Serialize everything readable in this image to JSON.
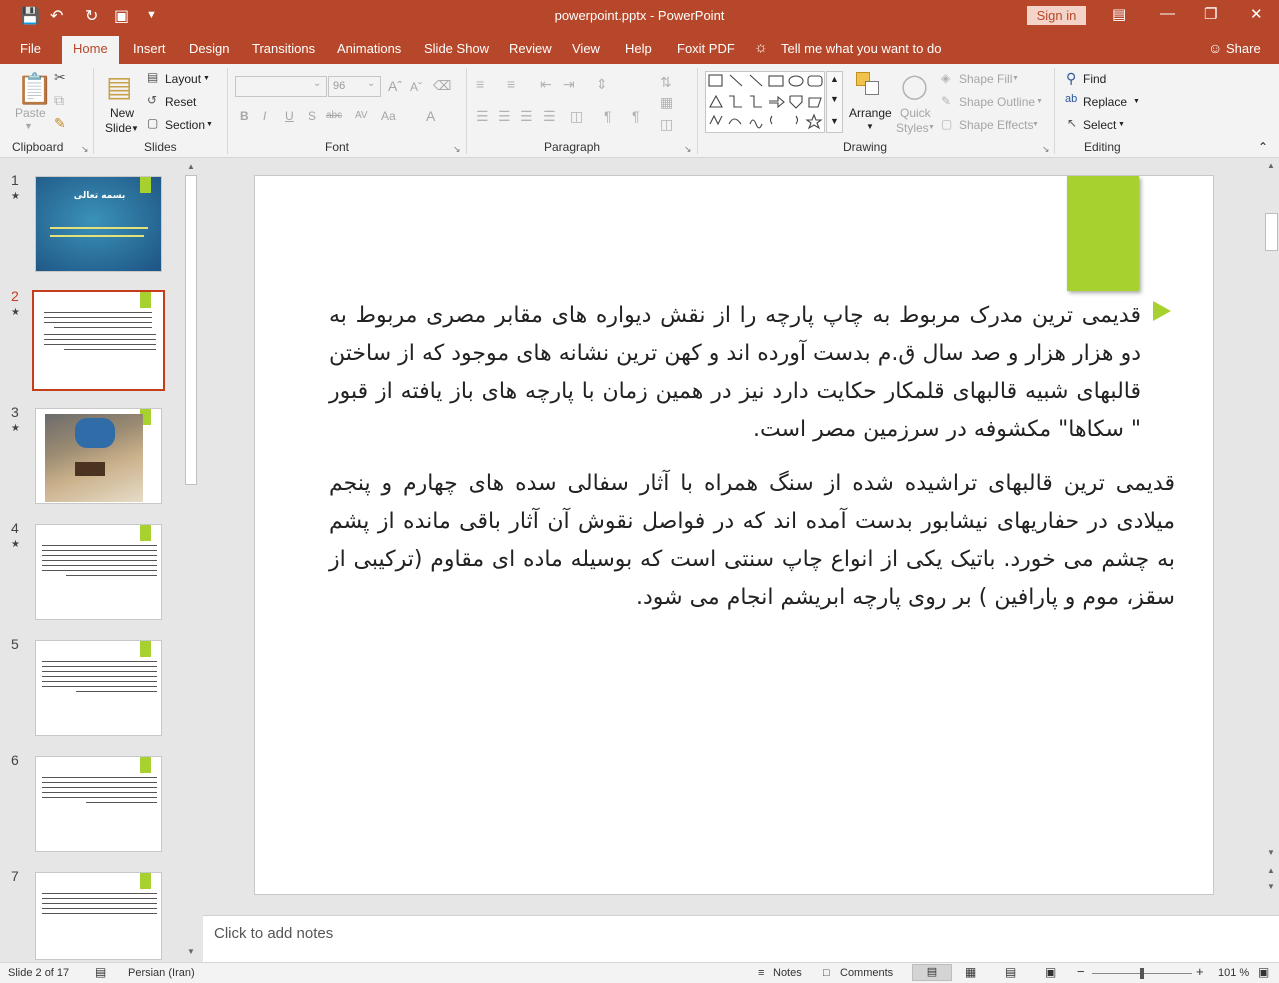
{
  "window": {
    "title": "powerpoint.pptx - PowerPoint",
    "sign_in": "Sign in"
  },
  "quick_access": {
    "save_icon": "save-icon",
    "undo_icon": "undo-icon",
    "redo_icon": "redo-icon",
    "present_icon": "present-icon",
    "customize_icon": "chevron-down-icon"
  },
  "tabs": [
    "File",
    "Home",
    "Insert",
    "Design",
    "Transitions",
    "Animations",
    "Slide Show",
    "Review",
    "View",
    "Help",
    "Foxit PDF"
  ],
  "tell_me": "Tell me what you want to do",
  "share": "Share",
  "ribbon": {
    "clipboard": {
      "label": "Clipboard",
      "paste": "Paste"
    },
    "slides": {
      "label": "Slides",
      "new_slide_1": "New",
      "new_slide_2": "Slide",
      "layout": "Layout",
      "reset": "Reset",
      "section": "Section"
    },
    "font": {
      "label": "Font",
      "font_name": "",
      "font_size": "96",
      "bold": "B",
      "italic": "I",
      "underline": "U",
      "shadow": "S",
      "strike": "abc",
      "spacing": "AV",
      "case": "Aa",
      "color": "A"
    },
    "paragraph": {
      "label": "Paragraph"
    },
    "drawing": {
      "label": "Drawing",
      "arrange": "Arrange",
      "quick_styles_1": "Quick",
      "quick_styles_2": "Styles",
      "shape_fill": "Shape Fill",
      "shape_outline": "Shape Outline",
      "shape_effects": "Shape Effects"
    },
    "editing": {
      "label": "Editing",
      "find": "Find",
      "replace": "Replace",
      "select": "Select"
    }
  },
  "thumbnails": [
    {
      "num": "1",
      "star": "★",
      "title_text": "بسمه تعالی"
    },
    {
      "num": "2",
      "star": "★"
    },
    {
      "num": "3",
      "star": "★"
    },
    {
      "num": "4",
      "star": "★"
    },
    {
      "num": "5"
    },
    {
      "num": "6"
    },
    {
      "num": "7"
    }
  ],
  "slide": {
    "paragraph_1": "قدیمی ترین مدرک مربوط به چاپ پارچه را از نقش دیواره های مقابر مصری مربوط به دو هزار هزار و صد سال ق.م بدست آورده اند و کهن ترین نشانه های موجود که از ساختن قالبهای شبیه قالبهای قلمکار حکایت دارد نیز در همین زمان با پارچه های باز یافته از قبور \" سکاها\" مکشوفه در سرزمین مصر است.",
    "paragraph_2": "قدیمی ترین قالبهای تراشیده شده از سنگ همراه با آثار سفالی سده های چهارم و پنجم میلادی در حفاریهای نیشابور بدست آمده اند که در فواصل نقوش آن آثار باقی مانده از پشم به چشم می خورد. باتیک یکی از انواع چاپ سنتی است که بوسیله ماده ای مقاوم (ترکیبی از سقز، موم و پارافین ) بر روی پارچه ابریشم انجام می شود."
  },
  "notes_placeholder": "Click to add notes",
  "status": {
    "slide_info": "Slide 2 of 17",
    "language": "Persian (Iran)",
    "notes": "Notes",
    "comments": "Comments",
    "zoom": "101 %",
    "zoom_minus": "−",
    "zoom_plus": "+"
  },
  "colors": {
    "accent": "#b7472a",
    "slide_green": "#a6d12e",
    "thumb_blue": "#2a6aa0"
  }
}
